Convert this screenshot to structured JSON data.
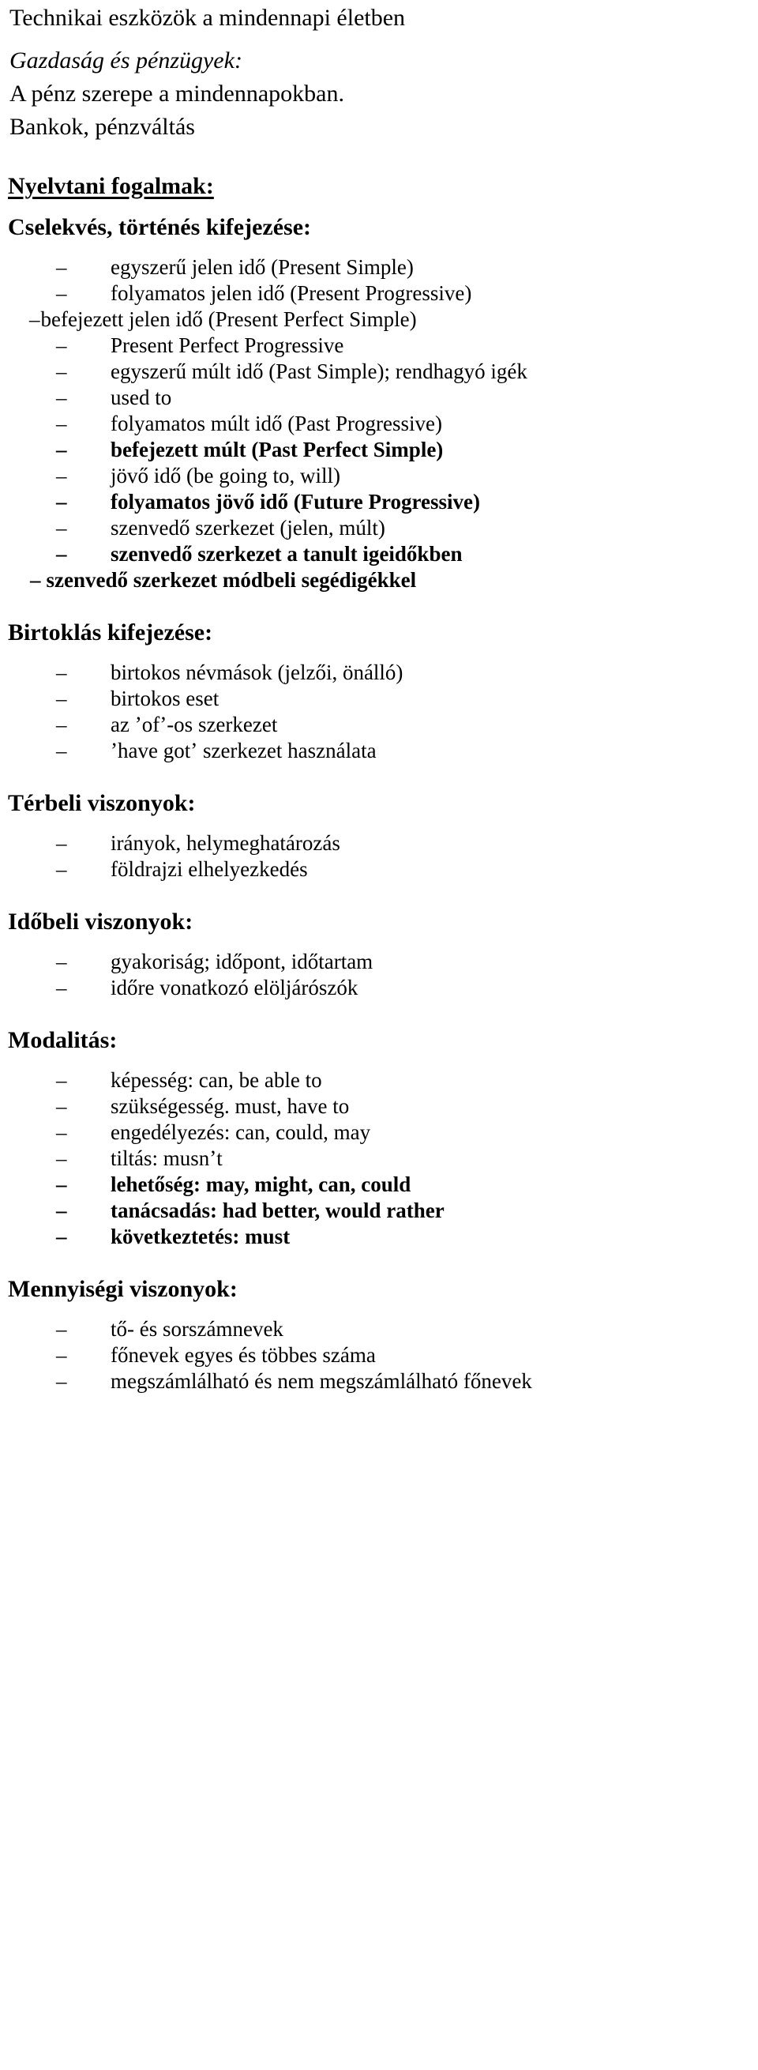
{
  "document": {
    "title": "Technikai eszközök a mindennapi életben",
    "intro": {
      "topic_italic": "Gazdaság és pénzügyek:",
      "line_1": "A pénz szerepe a mindennapokban.",
      "line_2": "Bankok, pénzváltás"
    },
    "grammar_heading": "Nyelvtani fogalmak: ",
    "sections": [
      {
        "id": "cselekves",
        "heading": "Cselekvés, történés kifejezése:",
        "items": [
          {
            "dash": "–",
            "text": "egyszerű jelen idő (Present Simple)",
            "bold": false,
            "style": "normal"
          },
          {
            "dash": "–",
            "text": "folyamatos jelen idő (Present Progressive)",
            "bold": false,
            "style": "normal"
          },
          {
            "dash": "–",
            "text": "befejezett jelen idő (Present Perfect Simple)",
            "bold": false,
            "style": "flush"
          },
          {
            "dash": "–",
            "text": "Present Perfect Progressive",
            "bold": false,
            "style": "normal"
          },
          {
            "dash": "–",
            "text": "egyszerű múlt idő (Past Simple); rendhagyó igék",
            "bold": false,
            "style": "normal"
          },
          {
            "dash": "–",
            "text": "used to",
            "bold": false,
            "style": "normal"
          },
          {
            "dash": "–",
            "text": "folyamatos múlt idő (Past Progressive)",
            "bold": false,
            "style": "normal"
          },
          {
            "dash": "–",
            "text": "befejezett múlt (Past Perfect Simple)",
            "bold": true,
            "style": "normal"
          },
          {
            "dash": "–",
            "text": "jövő idő (be going to, will)",
            "bold": false,
            "style": "normal"
          },
          {
            "dash": "–",
            "text": "folyamatos jövő idő (Future Progressive)",
            "bold": true,
            "style": "normal"
          },
          {
            "dash": "–",
            "text": "szenvedő szerkezet (jelen, múlt)",
            "bold": false,
            "style": "normal"
          },
          {
            "dash": "–",
            "text": "szenvedő szerkezet a tanult igeidőkben",
            "bold": true,
            "style": "normal"
          },
          {
            "dash": "–",
            "text": "szenvedő szerkezet módbeli segédigékkel",
            "bold": true,
            "style": "flush2"
          }
        ]
      },
      {
        "id": "birtoklas",
        "heading": "Birtoklás kifejezése:",
        "items": [
          {
            "dash": "–",
            "text": "birtokos névmások (jelzői, önálló)",
            "bold": false,
            "style": "normal"
          },
          {
            "dash": "–",
            "text": "birtokos eset",
            "bold": false,
            "style": "normal"
          },
          {
            "dash": "–",
            "text": "az ʼofʼ-os szerkezet",
            "bold": false,
            "style": "normal"
          },
          {
            "dash": "–",
            "text": "ʼhave gotʼ szerkezet használata",
            "bold": false,
            "style": "normal"
          }
        ]
      },
      {
        "id": "terbeli",
        "heading": "Térbeli viszonyok:",
        "items": [
          {
            "dash": "–",
            "text": "irányok, helymeghatározás",
            "bold": false,
            "style": "normal"
          },
          {
            "dash": "–",
            "text": "földrajzi elhelyezkedés",
            "bold": false,
            "style": "normal"
          }
        ]
      },
      {
        "id": "idobeli",
        "heading": "Időbeli viszonyok:",
        "items": [
          {
            "dash": "–",
            "text": "gyakoriság; időpont, időtartam",
            "bold": false,
            "style": "normal"
          },
          {
            "dash": "–",
            "text": "időre vonatkozó elöljárószók",
            "bold": false,
            "style": "normal"
          }
        ]
      },
      {
        "id": "modalitas",
        "heading": "Modalitás:",
        "items": [
          {
            "dash": "–",
            "text": "képesség: can, be able to",
            "bold": false,
            "style": "normal"
          },
          {
            "dash": "–",
            "text": "szükségesség. must, have to",
            "bold": false,
            "style": "normal"
          },
          {
            "dash": "–",
            "text": "engedélyezés: can, could, may",
            "bold": false,
            "style": "normal"
          },
          {
            "dash": "–",
            "text": "tiltás: musnʼt",
            "bold": false,
            "style": "normal"
          },
          {
            "dash": "–",
            "text": "lehetőség: may, might, can, could",
            "bold": true,
            "style": "normal"
          },
          {
            "dash": "–",
            "text": "tanácsadás: had better, would rather",
            "bold": true,
            "style": "normal"
          },
          {
            "dash": "–",
            "text": "következtetés: must",
            "bold": true,
            "style": "normal"
          }
        ]
      },
      {
        "id": "mennyisegi",
        "heading": "Mennyiségi viszonyok:",
        "items": [
          {
            "dash": "–",
            "text": "tő- és sorszámnevek",
            "bold": false,
            "style": "normal"
          },
          {
            "dash": "–",
            "text": "főnevek egyes és többes száma",
            "bold": false,
            "style": "normal"
          },
          {
            "dash": "–",
            "text": "megszámlálható és nem megszámlálható főnevek",
            "bold": false,
            "style": "normal"
          }
        ]
      }
    ]
  }
}
